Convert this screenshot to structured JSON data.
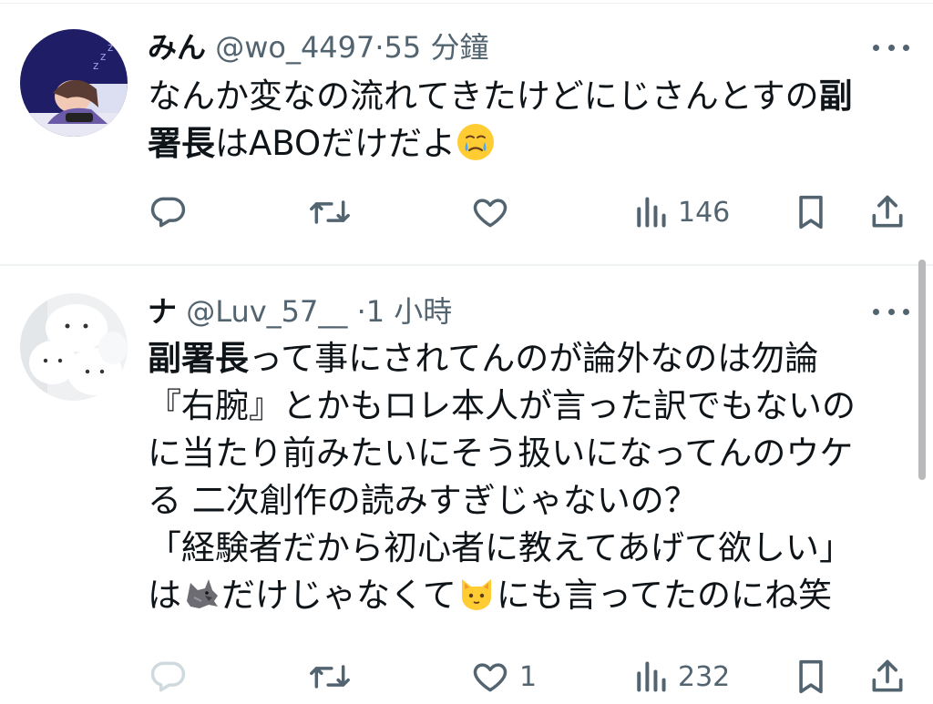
{
  "tweets": [
    {
      "name": "みん",
      "handle": "@wo_4497",
      "time": "·55 分鐘",
      "lines": [
        [
          {
            "t": "なんか変なの流れてきたけどにじさんとすの"
          },
          {
            "t": "副",
            "b": true
          }
        ],
        [
          {
            "t": "署長",
            "b": true
          },
          {
            "t": "はABOだけだよ"
          },
          {
            "emoji": "face-holding-back-tears"
          }
        ]
      ],
      "reply_count": "",
      "retweet_count": "",
      "like_count": "",
      "view_count": "146"
    },
    {
      "name": "ナ",
      "handle": "@Luv_57__",
      "time": "·1 小時",
      "lines": [
        [
          {
            "t": "副署長",
            "b": true
          },
          {
            "t": "って事にされてんのが論外なのは勿論"
          }
        ],
        [
          {
            "t": "『右腕』とかもロレ本人が言った訳でもないの"
          }
        ],
        [
          {
            "t": "に当たり前みたいにそう扱いになってんのウケ"
          }
        ],
        [
          {
            "t": "る 二次創作の読みすぎじゃないの？"
          }
        ],
        [
          {
            "t": "「経験者だから初心者に教えてあげて欲しい」"
          }
        ],
        [
          {
            "t": "は"
          },
          {
            "emoji": "wolf"
          },
          {
            "t": "だけじゃなくて"
          },
          {
            "emoji": "cat-face"
          },
          {
            "t": "にも言ってたのにね笑"
          }
        ]
      ],
      "reply_count": "",
      "retweet_count": "",
      "like_count": "1",
      "view_count": "232"
    }
  ],
  "icons": [
    "reply-icon",
    "retweet-icon",
    "like-icon",
    "views-icon",
    "bookmark-icon",
    "share-icon",
    "more-icon"
  ],
  "colors": {
    "text": "#0f1419",
    "secondary": "#536471",
    "divider": "#eff3f4",
    "action_faded": "#cfd9de"
  }
}
